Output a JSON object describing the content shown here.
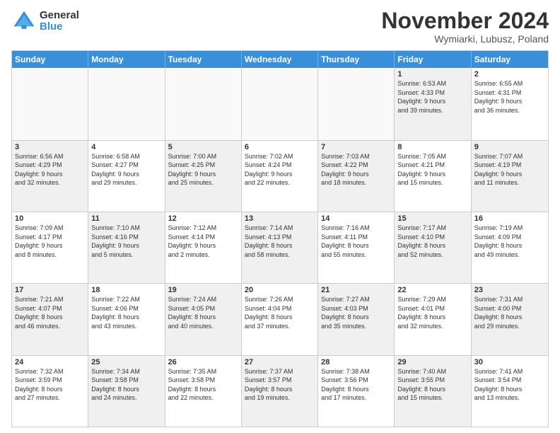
{
  "header": {
    "logo_line1": "General",
    "logo_line2": "Blue",
    "month": "November 2024",
    "location": "Wymiarki, Lubusz, Poland"
  },
  "weekdays": [
    "Sunday",
    "Monday",
    "Tuesday",
    "Wednesday",
    "Thursday",
    "Friday",
    "Saturday"
  ],
  "weeks": [
    [
      {
        "day": "",
        "info": "",
        "empty": true
      },
      {
        "day": "",
        "info": "",
        "empty": true
      },
      {
        "day": "",
        "info": "",
        "empty": true
      },
      {
        "day": "",
        "info": "",
        "empty": true
      },
      {
        "day": "",
        "info": "",
        "empty": true
      },
      {
        "day": "1",
        "info": "Sunrise: 6:53 AM\nSunset: 4:33 PM\nDaylight: 9 hours\nand 39 minutes.",
        "shaded": true
      },
      {
        "day": "2",
        "info": "Sunrise: 6:55 AM\nSunset: 4:31 PM\nDaylight: 9 hours\nand 36 minutes.",
        "shaded": false
      }
    ],
    [
      {
        "day": "3",
        "info": "Sunrise: 6:56 AM\nSunset: 4:29 PM\nDaylight: 9 hours\nand 32 minutes.",
        "shaded": true
      },
      {
        "day": "4",
        "info": "Sunrise: 6:58 AM\nSunset: 4:27 PM\nDaylight: 9 hours\nand 29 minutes.",
        "shaded": false
      },
      {
        "day": "5",
        "info": "Sunrise: 7:00 AM\nSunset: 4:25 PM\nDaylight: 9 hours\nand 25 minutes.",
        "shaded": true
      },
      {
        "day": "6",
        "info": "Sunrise: 7:02 AM\nSunset: 4:24 PM\nDaylight: 9 hours\nand 22 minutes.",
        "shaded": false
      },
      {
        "day": "7",
        "info": "Sunrise: 7:03 AM\nSunset: 4:22 PM\nDaylight: 9 hours\nand 18 minutes.",
        "shaded": true
      },
      {
        "day": "8",
        "info": "Sunrise: 7:05 AM\nSunset: 4:21 PM\nDaylight: 9 hours\nand 15 minutes.",
        "shaded": false
      },
      {
        "day": "9",
        "info": "Sunrise: 7:07 AM\nSunset: 4:19 PM\nDaylight: 9 hours\nand 11 minutes.",
        "shaded": true
      }
    ],
    [
      {
        "day": "10",
        "info": "Sunrise: 7:09 AM\nSunset: 4:17 PM\nDaylight: 9 hours\nand 8 minutes.",
        "shaded": false
      },
      {
        "day": "11",
        "info": "Sunrise: 7:10 AM\nSunset: 4:16 PM\nDaylight: 9 hours\nand 5 minutes.",
        "shaded": true
      },
      {
        "day": "12",
        "info": "Sunrise: 7:12 AM\nSunset: 4:14 PM\nDaylight: 9 hours\nand 2 minutes.",
        "shaded": false
      },
      {
        "day": "13",
        "info": "Sunrise: 7:14 AM\nSunset: 4:13 PM\nDaylight: 8 hours\nand 58 minutes.",
        "shaded": true
      },
      {
        "day": "14",
        "info": "Sunrise: 7:16 AM\nSunset: 4:11 PM\nDaylight: 8 hours\nand 55 minutes.",
        "shaded": false
      },
      {
        "day": "15",
        "info": "Sunrise: 7:17 AM\nSunset: 4:10 PM\nDaylight: 8 hours\nand 52 minutes.",
        "shaded": true
      },
      {
        "day": "16",
        "info": "Sunrise: 7:19 AM\nSunset: 4:09 PM\nDaylight: 8 hours\nand 49 minutes.",
        "shaded": false
      }
    ],
    [
      {
        "day": "17",
        "info": "Sunrise: 7:21 AM\nSunset: 4:07 PM\nDaylight: 8 hours\nand 46 minutes.",
        "shaded": true
      },
      {
        "day": "18",
        "info": "Sunrise: 7:22 AM\nSunset: 4:06 PM\nDaylight: 8 hours\nand 43 minutes.",
        "shaded": false
      },
      {
        "day": "19",
        "info": "Sunrise: 7:24 AM\nSunset: 4:05 PM\nDaylight: 8 hours\nand 40 minutes.",
        "shaded": true
      },
      {
        "day": "20",
        "info": "Sunrise: 7:26 AM\nSunset: 4:04 PM\nDaylight: 8 hours\nand 37 minutes.",
        "shaded": false
      },
      {
        "day": "21",
        "info": "Sunrise: 7:27 AM\nSunset: 4:03 PM\nDaylight: 8 hours\nand 35 minutes.",
        "shaded": true
      },
      {
        "day": "22",
        "info": "Sunrise: 7:29 AM\nSunset: 4:01 PM\nDaylight: 8 hours\nand 32 minutes.",
        "shaded": false
      },
      {
        "day": "23",
        "info": "Sunrise: 7:31 AM\nSunset: 4:00 PM\nDaylight: 8 hours\nand 29 minutes.",
        "shaded": true
      }
    ],
    [
      {
        "day": "24",
        "info": "Sunrise: 7:32 AM\nSunset: 3:59 PM\nDaylight: 8 hours\nand 27 minutes.",
        "shaded": false
      },
      {
        "day": "25",
        "info": "Sunrise: 7:34 AM\nSunset: 3:58 PM\nDaylight: 8 hours\nand 24 minutes.",
        "shaded": true
      },
      {
        "day": "26",
        "info": "Sunrise: 7:35 AM\nSunset: 3:58 PM\nDaylight: 8 hours\nand 22 minutes.",
        "shaded": false
      },
      {
        "day": "27",
        "info": "Sunrise: 7:37 AM\nSunset: 3:57 PM\nDaylight: 8 hours\nand 19 minutes.",
        "shaded": true
      },
      {
        "day": "28",
        "info": "Sunrise: 7:38 AM\nSunset: 3:56 PM\nDaylight: 8 hours\nand 17 minutes.",
        "shaded": false
      },
      {
        "day": "29",
        "info": "Sunrise: 7:40 AM\nSunset: 3:55 PM\nDaylight: 8 hours\nand 15 minutes.",
        "shaded": true
      },
      {
        "day": "30",
        "info": "Sunrise: 7:41 AM\nSunset: 3:54 PM\nDaylight: 8 hours\nand 13 minutes.",
        "shaded": false
      }
    ]
  ]
}
